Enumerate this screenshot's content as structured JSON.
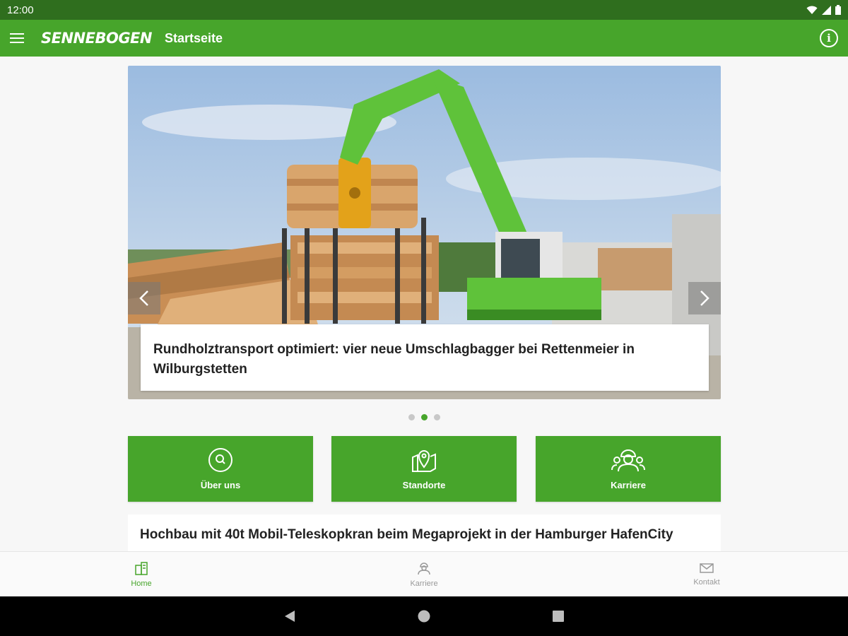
{
  "status_bar": {
    "time": "12:00"
  },
  "app_bar": {
    "logo_text": "SENNEBOGEN",
    "title": "Startseite"
  },
  "carousel": {
    "slide_caption": "Rundholztransport optimiert: vier neue Umschlagbagger bei Rettenmeier in Wilburgstetten",
    "slide_count": 3,
    "active_slide": 2
  },
  "tiles": [
    {
      "label": "Über uns",
      "icon": "search-icon"
    },
    {
      "label": "Standorte",
      "icon": "map-pin-icon"
    },
    {
      "label": "Karriere",
      "icon": "workers-icon"
    }
  ],
  "news": {
    "headline": "Hochbau mit 40t Mobil-Teleskopkran beim Megaprojekt in der Hamburger HafenCity"
  },
  "bottom_nav": [
    {
      "label": "Home",
      "icon": "building-icon",
      "active": true
    },
    {
      "label": "Karriere",
      "icon": "workers-icon",
      "active": false
    },
    {
      "label": "Kontakt",
      "icon": "mail-icon",
      "active": false
    }
  ],
  "colors": {
    "primary": "#47a52b",
    "status_bar": "#2f6e1e",
    "inactive": "#999999"
  }
}
